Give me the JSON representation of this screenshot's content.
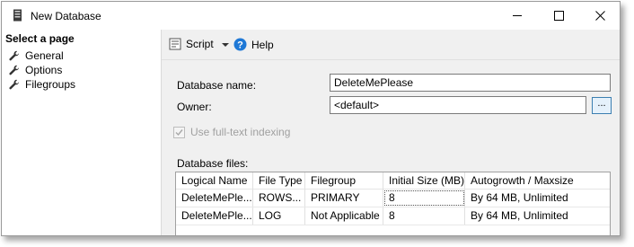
{
  "window": {
    "title": "New Database",
    "controls": {
      "minimize": "minimize",
      "maximize": "maximize",
      "close": "close"
    }
  },
  "nav": {
    "header": "Select a page",
    "items": [
      {
        "label": "General",
        "icon": "wrench-icon"
      },
      {
        "label": "Options",
        "icon": "wrench-icon"
      },
      {
        "label": "Filegroups",
        "icon": "wrench-icon"
      }
    ]
  },
  "toolbar": {
    "script_label": "Script",
    "help_label": "Help"
  },
  "form": {
    "db_name_label": "Database name:",
    "db_name_value": "DeleteMePlease",
    "owner_label": "Owner:",
    "owner_value": "<default>",
    "browse_label": "...",
    "fulltext_label": "Use full-text indexing",
    "fulltext_checked": true,
    "files_label": "Database files:"
  },
  "grid": {
    "columns": [
      "Logical Name",
      "File Type",
      "Filegroup",
      "Initial Size (MB)",
      "Autogrowth / Maxsize"
    ],
    "rows": [
      [
        "DeleteMePle...",
        "ROWS...",
        "PRIMARY",
        "8",
        "By 64 MB, Unlimited"
      ],
      [
        "DeleteMePle...",
        "LOG",
        "Not Applicable",
        "8",
        "By 64 MB, Unlimited"
      ]
    ]
  },
  "colors": {
    "content_bg": "#f0f0f0",
    "help_icon": "#1e78d6",
    "browse_border": "#3c7fb1"
  }
}
